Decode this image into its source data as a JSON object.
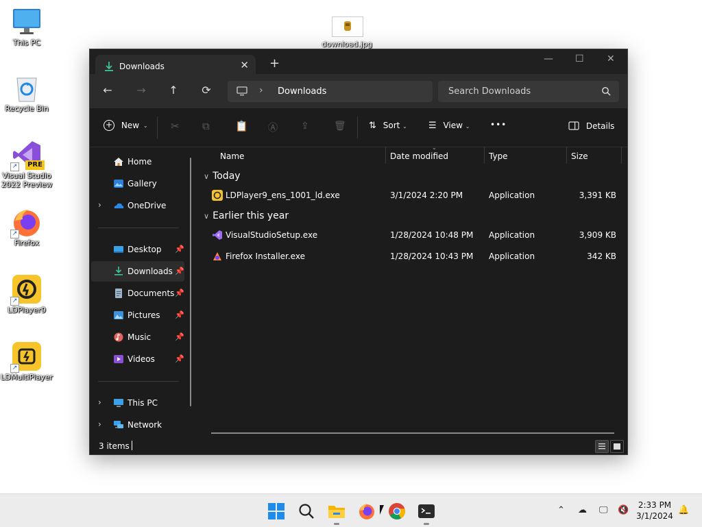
{
  "desktop": {
    "icons": [
      {
        "label": "This PC"
      },
      {
        "label": "Recycle Bin"
      },
      {
        "label": "Visual Studio 2022 Preview",
        "badge": "PRE"
      },
      {
        "label": "Firefox"
      },
      {
        "label": "LDPlayer9"
      },
      {
        "label": "LDMultiPlayer"
      }
    ],
    "file_label": "download.jpg"
  },
  "window": {
    "tab_title": "Downloads",
    "new_tab": "+",
    "address": {
      "crumb": "Downloads"
    },
    "search_placeholder": "Search Downloads",
    "toolbar": {
      "new_label": "New",
      "sort_label": "Sort",
      "view_label": "View",
      "more_label": "•••",
      "details_label": "Details"
    },
    "sidebar": {
      "items": [
        {
          "label": "Home",
          "icon": "home-icon"
        },
        {
          "label": "Gallery",
          "icon": "gallery-icon"
        },
        {
          "label": "OneDrive",
          "icon": "onedrive-icon"
        },
        {
          "label": "Desktop",
          "icon": "desktop-folder-icon"
        },
        {
          "label": "Downloads",
          "icon": "downloads-icon",
          "selected": true
        },
        {
          "label": "Documents",
          "icon": "documents-icon"
        },
        {
          "label": "Pictures",
          "icon": "pictures-icon"
        },
        {
          "label": "Music",
          "icon": "music-icon"
        },
        {
          "label": "Videos",
          "icon": "videos-icon"
        },
        {
          "label": "This PC",
          "icon": "this-pc-icon"
        },
        {
          "label": "Network",
          "icon": "network-icon"
        }
      ]
    },
    "columns": {
      "name": "Name",
      "date": "Date modified",
      "type": "Type",
      "size": "Size"
    },
    "groups": [
      {
        "title": "Today",
        "files": [
          {
            "name": "LDPlayer9_ens_1001_ld.exe",
            "date": "3/1/2024 2:20 PM",
            "type": "Application",
            "size": "3,391 KB"
          }
        ]
      },
      {
        "title": "Earlier this year",
        "files": [
          {
            "name": "VisualStudioSetup.exe",
            "date": "1/28/2024 10:48 PM",
            "type": "Application",
            "size": "3,909 KB"
          },
          {
            "name": "Firefox Installer.exe",
            "date": "1/28/2024 10:43 PM",
            "type": "Application",
            "size": "342 KB"
          }
        ]
      }
    ],
    "status": {
      "count": "3 items"
    }
  },
  "taskbar": {
    "clock_time": "2:33 PM",
    "clock_date": "3/1/2024"
  }
}
